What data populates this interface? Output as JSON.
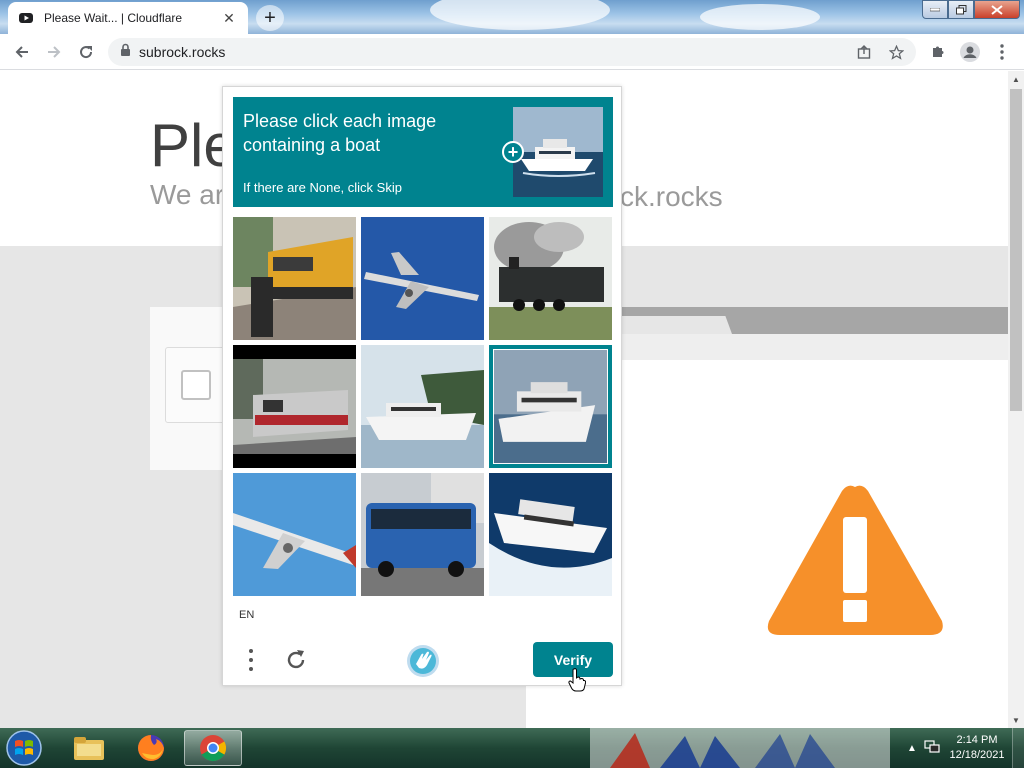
{
  "browser": {
    "tab_title": "Please Wait... | Cloudflare",
    "tab_close": "✕",
    "new_tab": "+",
    "url": "subrock.rocks"
  },
  "page": {
    "title_fragment": "Ple",
    "subtitle_fragment": "We ar",
    "subtitle_fragment_right": "ck.rocks"
  },
  "captcha": {
    "prompt": "Please click each image containing a boat",
    "hint": "If there are None, click Skip",
    "language": "EN",
    "verify_label": "Verify",
    "tiles": [
      {
        "subject": "train",
        "selected": false
      },
      {
        "subject": "airplane",
        "selected": false
      },
      {
        "subject": "steam-train",
        "selected": false
      },
      {
        "subject": "train",
        "selected": false
      },
      {
        "subject": "boat",
        "selected": false
      },
      {
        "subject": "boat",
        "selected": true
      },
      {
        "subject": "airplane",
        "selected": false
      },
      {
        "subject": "bus",
        "selected": false
      },
      {
        "subject": "boat",
        "selected": false
      }
    ],
    "accent_color": "#00838f"
  },
  "taskbar": {
    "time": "2:14 PM",
    "date": "12/18/2021"
  }
}
